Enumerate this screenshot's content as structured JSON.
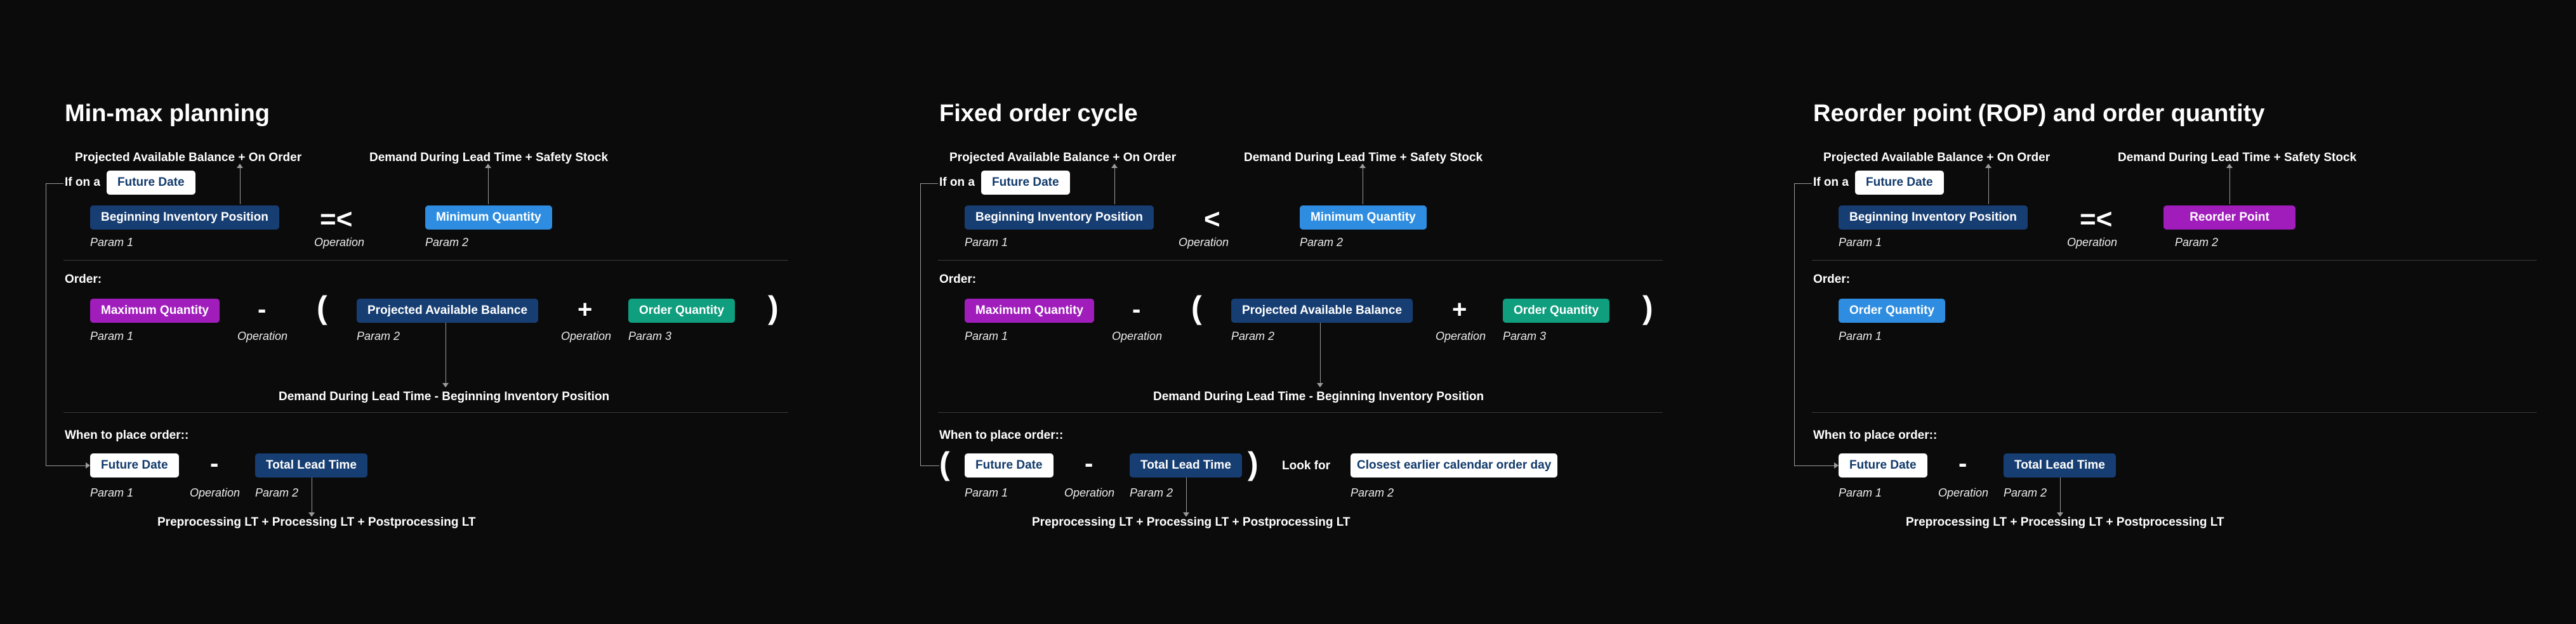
{
  "panels": [
    {
      "title": "Min-max planning",
      "top_annot_left": "Projected Available Balance + On Order",
      "top_annot_right": "Demand During Lead Time + Safety Stock",
      "if_on_a": "If on a",
      "future_date": "Future Date",
      "beginning_inventory": "Beginning Inventory Position",
      "condition_op": "=<",
      "threshold": "Minimum Quantity",
      "param1": "Param 1",
      "param2": "Param 2",
      "param3": "Param 3",
      "operation": "Operation",
      "order_label": "Order:",
      "max_qty": "Maximum Quantity",
      "minus": "-",
      "open_paren": "(",
      "close_paren": ")",
      "pab": "Projected Available Balance",
      "plus": "+",
      "order_qty": "Order Quantity",
      "demand_minus": "Demand During Lead Time - Beginning Inventory Position",
      "when_label": "When to place order::",
      "total_lead_time": "Total Lead Time",
      "lt_sum": "Preprocessing LT + Processing LT + Postprocessing LT"
    },
    {
      "title": "Fixed order cycle",
      "top_annot_left": "Projected Available Balance + On Order",
      "top_annot_right": "Demand During Lead Time + Safety Stock",
      "if_on_a": "If on a",
      "future_date": "Future Date",
      "beginning_inventory": "Beginning Inventory Position",
      "condition_op": "<",
      "threshold": "Minimum Quantity",
      "param1": "Param 1",
      "param2": "Param 2",
      "param3": "Param 3",
      "operation": "Operation",
      "order_label": "Order:",
      "max_qty": "Maximum Quantity",
      "minus": "-",
      "open_paren": "(",
      "close_paren": ")",
      "pab": "Projected Available Balance",
      "plus": "+",
      "order_qty": "Order Quantity",
      "demand_minus": "Demand During Lead Time - Beginning Inventory Position",
      "when_label": "When to place order::",
      "total_lead_time": "Total Lead Time",
      "look_for": "Look for",
      "closest_day": "Closest earlier calendar order day",
      "lt_sum": "Preprocessing LT + Processing LT + Postprocessing LT"
    },
    {
      "title": "Reorder point (ROP) and order quantity",
      "top_annot_left": "Projected Available Balance + On Order",
      "top_annot_right": "Demand During Lead Time + Safety Stock",
      "if_on_a": "If on a",
      "future_date": "Future Date",
      "beginning_inventory": "Beginning Inventory Position",
      "condition_op": "=<",
      "threshold": "Reorder Point",
      "param1": "Param 1",
      "param2": "Param 2",
      "operation": "Operation",
      "order_label": "Order:",
      "order_qty": "Order Quantity",
      "minus": "-",
      "when_label": "When to place order::",
      "total_lead_time": "Total Lead Time",
      "lt_sum": "Preprocessing LT + Processing LT + Postprocessing LT"
    }
  ]
}
